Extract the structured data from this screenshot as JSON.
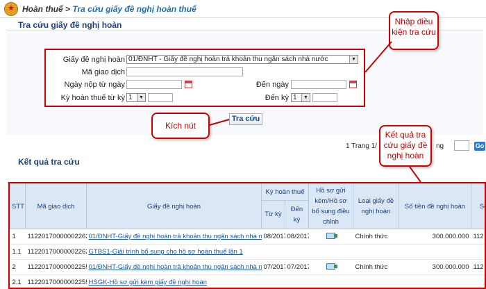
{
  "breadcrumb": {
    "root": "Hoàn thuế",
    "separator": ">",
    "current": "Tra cứu giấy đề nghị hoàn thuế"
  },
  "page_title": "Tra cứu giấy đề nghị hoàn",
  "form": {
    "request_label": "Giấy đề nghị hoàn",
    "request_value": "01/ĐNHT - Giấy đề nghị hoàn trả khoản thu ngân sách nhà nước",
    "tx_code_label": "Mã giao dịch",
    "tx_code_value": "",
    "from_date_label": "Ngày nộp từ ngày",
    "to_date_label": "Đến ngày",
    "period_from_label": "Kỳ hoàn thuế từ kỳ",
    "period_from_value": "1",
    "period_to_label": "Đến kỳ",
    "period_to_value": "1"
  },
  "search_button": "Tra cứu",
  "callouts": {
    "conditions": "Nhập điều kiện tra cứu",
    "click": "Kích nút",
    "results": "Kết quả tra cứu giấy đề nghị hoàn"
  },
  "pager": {
    "left_text": "1 Trang 1/",
    "right_text": "ng",
    "go": "Go"
  },
  "results_title": "Kết quả tra cứu",
  "table": {
    "headers": {
      "stt": "STT",
      "tx_code": "Mã giao dịch",
      "request": "Giấy đề nghị hoàn",
      "period": "Kỳ hoàn thuế",
      "period_from": "Từ kỳ",
      "period_to": "Đến kỳ",
      "attachments": "Hồ sơ gửi kèm/Hồ sơ bổ sung điều chỉnh",
      "type": "Loại giấy đề nghị hoàn",
      "amount": "Số tiền đề nghị hoàn",
      "extra": "Số"
    },
    "rows": [
      {
        "stt": "1",
        "tx_code": "11220170000002262",
        "request": "01/ĐNHT-Giấy đề nghị hoàn trả khoản thu ngân sách nhà nước",
        "from": "08/2017",
        "to": "08/2017",
        "icon": "attachment-icon",
        "type": "Chính thức",
        "amount": "300.000.000",
        "extra": "112"
      },
      {
        "stt": "1.1",
        "tx_code": "11220170000002262",
        "request": "GTBS1-Giải trình bổ sung cho hồ sơ hoàn thuế lần 1",
        "from": "",
        "to": "",
        "icon": "",
        "type": "",
        "amount": "",
        "extra": ""
      },
      {
        "stt": "2",
        "tx_code": "11220170000002255",
        "request": "01/ĐNHT-Giấy đề nghị hoàn trả khoản thu ngân sách nhà nước",
        "from": "07/2017",
        "to": "07/2017",
        "icon": "attachment-icon",
        "type": "Chính thức",
        "amount": "300.000.000",
        "extra": "112"
      },
      {
        "stt": "2.1",
        "tx_code": "11220170000002255",
        "request": "HSGK-Hồ sơ gửi kèm giấy đề nghị hoàn",
        "from": "",
        "to": "",
        "icon": "",
        "type": "",
        "amount": "",
        "extra": ""
      }
    ]
  }
}
